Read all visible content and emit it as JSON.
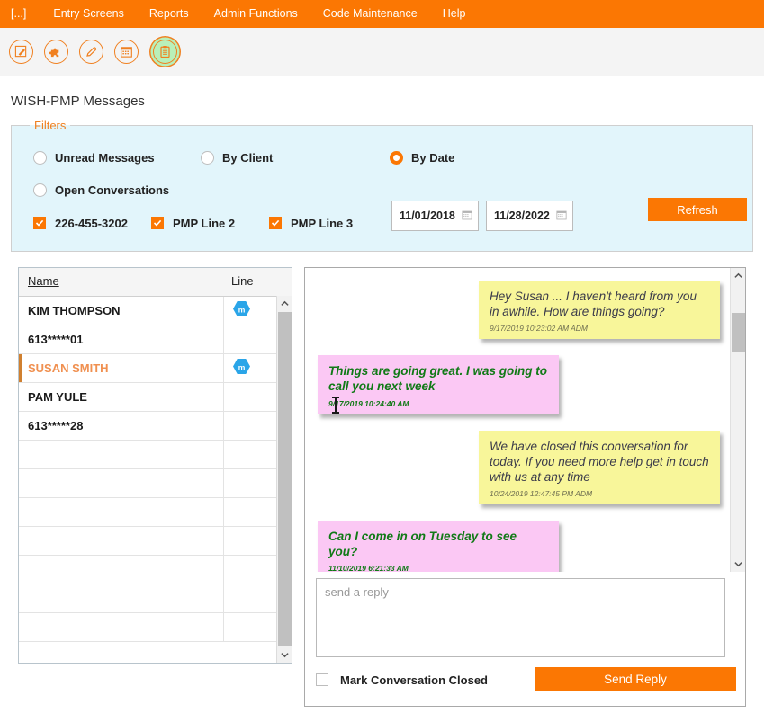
{
  "nav": {
    "items": [
      {
        "label": "[...]",
        "name": "nav-home"
      },
      {
        "label": "Entry Screens",
        "name": "nav-entry-screens"
      },
      {
        "label": "Reports",
        "name": "nav-reports"
      },
      {
        "label": "Admin Functions",
        "name": "nav-admin-functions"
      },
      {
        "label": "Code Maintenance",
        "name": "nav-code-maintenance"
      },
      {
        "label": "Help",
        "name": "nav-help"
      }
    ],
    "background": "#fb7703"
  },
  "toolbar": {
    "icons": [
      {
        "name": "edit-note-icon",
        "active": false
      },
      {
        "name": "puzzle-piece-icon",
        "active": false
      },
      {
        "name": "pencil-icon",
        "active": false
      },
      {
        "name": "calendar-icon",
        "active": false
      },
      {
        "name": "clipboard-icon",
        "active": true
      }
    ],
    "active_highlight": "#b9f0b9"
  },
  "page": {
    "title": "WISH-PMP Messages"
  },
  "filters": {
    "legend": "Filters",
    "background": "#e2f5fb",
    "legend_color": "#f08020",
    "radios": [
      {
        "label": "Unread Messages",
        "checked": false,
        "name": "radio-unread-messages"
      },
      {
        "label": "Open Conversations",
        "checked": false,
        "name": "radio-open-conversations"
      },
      {
        "label": "By Client",
        "checked": false,
        "name": "radio-by-client"
      },
      {
        "label": "By Date",
        "checked": true,
        "name": "radio-by-date"
      }
    ],
    "checkboxes": [
      {
        "label": "226-455-3202",
        "checked": true,
        "name": "checkbox-line-226-455-3202"
      },
      {
        "label": "PMP Line 2",
        "checked": true,
        "name": "checkbox-pmp-line-2"
      },
      {
        "label": "PMP Line 3",
        "checked": true,
        "name": "checkbox-pmp-line-3"
      }
    ],
    "date_from": "11/01/2018",
    "date_to": "11/28/2022",
    "refresh_label": "Refresh",
    "accent": "#fb7703"
  },
  "list": {
    "columns": [
      "Name",
      "Line"
    ],
    "rows": [
      {
        "name": "KIM THOMPSON",
        "badge": "m",
        "selected": false
      },
      {
        "name": "613*****01",
        "badge": "",
        "selected": false
      },
      {
        "name": "SUSAN SMITH",
        "badge": "m",
        "selected": true
      },
      {
        "name": "PAM YULE",
        "badge": "",
        "selected": false
      },
      {
        "name": "613*****28",
        "badge": "",
        "selected": false
      },
      {
        "name": "",
        "badge": "",
        "selected": false
      },
      {
        "name": "",
        "badge": "",
        "selected": false
      },
      {
        "name": "",
        "badge": "",
        "selected": false
      },
      {
        "name": "",
        "badge": "",
        "selected": false
      },
      {
        "name": "",
        "badge": "",
        "selected": false
      },
      {
        "name": "",
        "badge": "",
        "selected": false
      },
      {
        "name": "",
        "badge": "",
        "selected": false
      }
    ],
    "badge_color": "#2aa5e8"
  },
  "conversation": {
    "messages": [
      {
        "direction": "out",
        "text": "Hey Susan ... I haven't heard from you in awhile. How are things going?",
        "timestamp": "9/17/2019 10:23:02 AM ADM"
      },
      {
        "direction": "in",
        "text": "Things are going great. I was going to call you next week",
        "timestamp": "9/17/2019 10:24:40 AM"
      },
      {
        "direction": "out",
        "text": "We have closed this conversation for today. If you need more help get in touch with us at any time",
        "timestamp": "10/24/2019 12:47:45 PM ADM"
      },
      {
        "direction": "in",
        "text": "Can I come in on Tuesday to see you?",
        "timestamp": "11/10/2019 6:21:33 AM"
      }
    ],
    "outgoing_color": "#f8f69a",
    "incoming_color": "#fbc8f4",
    "reply_placeholder": "send a reply",
    "reply_value": "",
    "mark_closed_label": "Mark Conversation Closed",
    "mark_closed_checked": false,
    "send_label": "Send Reply"
  }
}
